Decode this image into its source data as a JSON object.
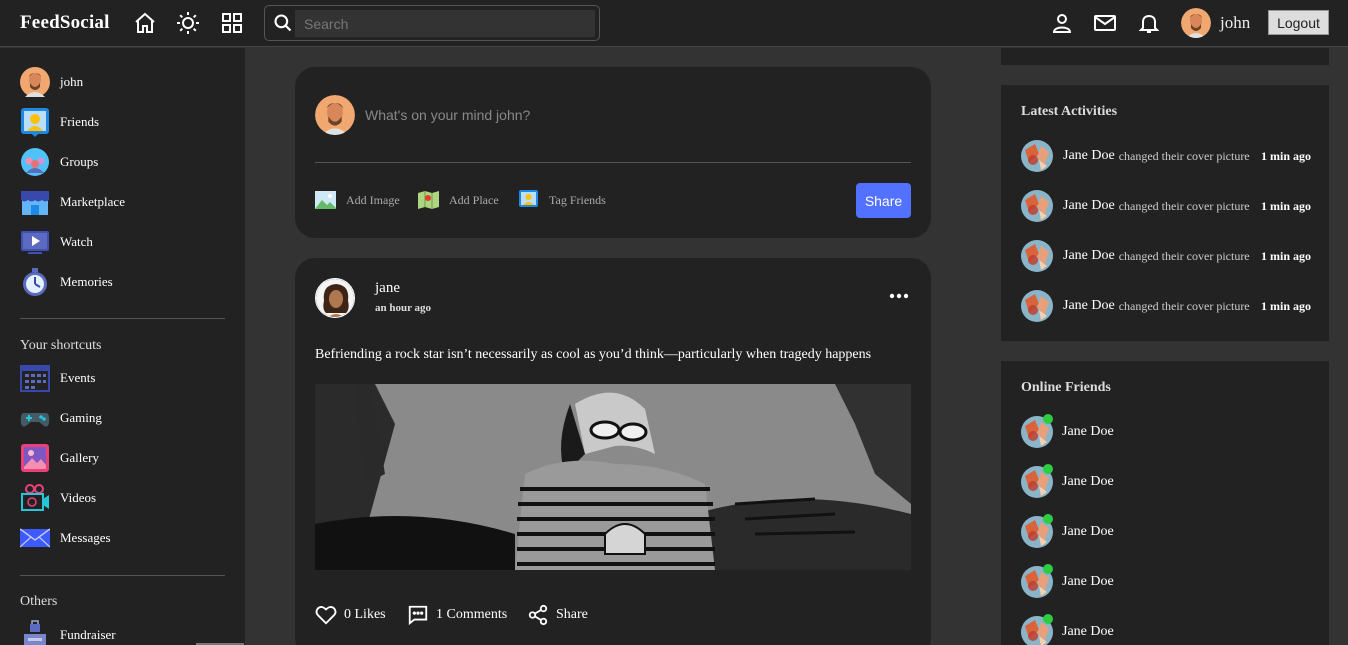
{
  "navbar": {
    "logo": "FeedSocial",
    "search_placeholder": "Search",
    "username": "john",
    "logout_label": "Logout"
  },
  "sidebar": {
    "user": "john",
    "items": [
      {
        "label": "Friends",
        "icon": "friends-icon"
      },
      {
        "label": "Groups",
        "icon": "groups-icon"
      },
      {
        "label": "Marketplace",
        "icon": "marketplace-icon"
      },
      {
        "label": "Watch",
        "icon": "watch-icon"
      },
      {
        "label": "Memories",
        "icon": "memories-icon"
      }
    ],
    "shortcuts_heading": "Your shortcuts",
    "shortcuts": [
      {
        "label": "Events",
        "icon": "events-icon"
      },
      {
        "label": "Gaming",
        "icon": "gaming-icon"
      },
      {
        "label": "Gallery",
        "icon": "gallery-icon"
      },
      {
        "label": "Videos",
        "icon": "videos-icon"
      },
      {
        "label": "Messages",
        "icon": "messages-icon"
      }
    ],
    "others_heading": "Others",
    "others": [
      {
        "label": "Fundraiser",
        "icon": "fundraiser-icon"
      }
    ]
  },
  "composer": {
    "placeholder": "What's on your mind john?",
    "actions": [
      "Add Image",
      "Add Place",
      "Tag Friends"
    ],
    "share_label": "Share"
  },
  "post": {
    "author": "jane",
    "time": "an hour ago",
    "text": "Befriending a rock star isn’t necessarily as cool as you’d think—particularly when tragedy happens",
    "likes": "0 Likes",
    "comments": "1 Comments",
    "share": "Share"
  },
  "activities": {
    "title": "Latest Activities",
    "items": [
      {
        "name": "Jane Doe",
        "desc": "changed their cover picture",
        "time": "1 min ago"
      },
      {
        "name": "Jane Doe",
        "desc": "changed their cover picture",
        "time": "1 min ago"
      },
      {
        "name": "Jane Doe",
        "desc": "changed their cover picture",
        "time": "1 min ago"
      },
      {
        "name": "Jane Doe",
        "desc": "changed their cover picture",
        "time": "1 min ago"
      }
    ]
  },
  "online_friends": {
    "title": "Online Friends",
    "items": [
      "Jane Doe",
      "Jane Doe",
      "Jane Doe",
      "Jane Doe",
      "Jane Doe"
    ]
  },
  "colors": {
    "accent": "#5271ff",
    "online": "#2ecc40",
    "panel": "#222222",
    "background": "#333333"
  }
}
